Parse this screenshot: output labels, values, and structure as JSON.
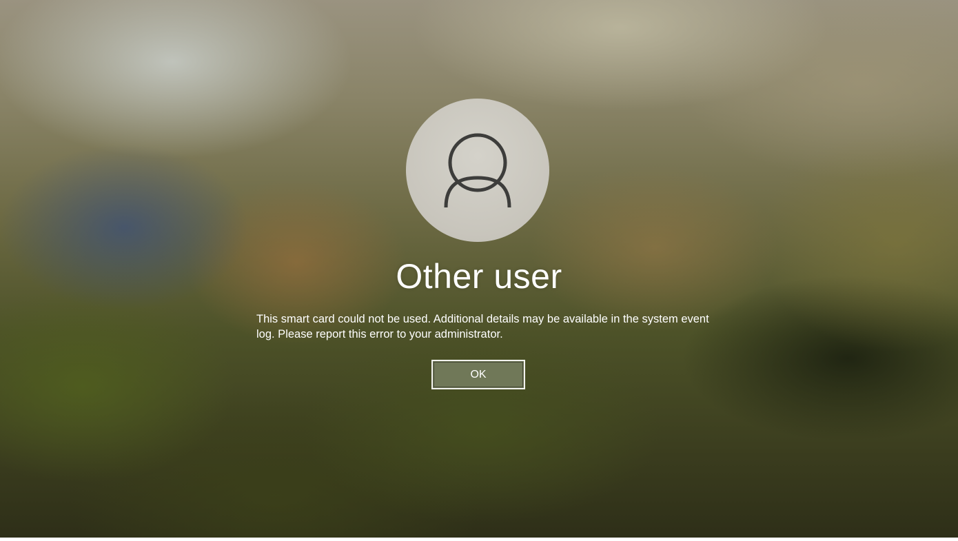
{
  "login": {
    "avatar_icon": "user-silhouette-icon",
    "user_name": "Other user",
    "error_message": "This smart card could not be used. Additional details may be available in the system event log. Please report this error to your administrator.",
    "ok_label": "OK"
  },
  "colors": {
    "text": "#ffffff",
    "avatar_bg": "#c8c5bc",
    "avatar_icon": "#3d3d3b",
    "button_border": "#f2f2ee",
    "button_fill": "#6f7656"
  }
}
